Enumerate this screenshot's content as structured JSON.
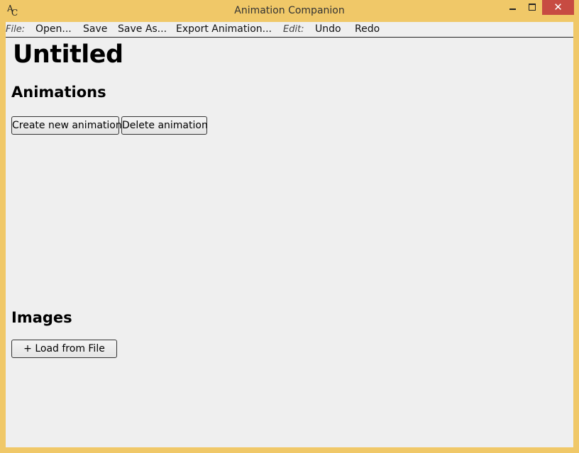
{
  "window": {
    "title": "Animation Companion",
    "icon_glyphs": {
      "a": "A",
      "c": "C"
    },
    "close_glyph": "✕"
  },
  "menubar": {
    "file_label": "File:",
    "file_items": [
      "Open...",
      "Save",
      "Save As...",
      "Export Animation..."
    ],
    "edit_label": "Edit:",
    "edit_items": [
      "Undo",
      "Redo"
    ]
  },
  "document": {
    "title": "Untitled"
  },
  "animations": {
    "heading": "Animations",
    "create_label": "Create new animation",
    "delete_label": "Delete animation"
  },
  "images": {
    "heading": "Images",
    "load_label": "+ Load from File"
  },
  "colors": {
    "frame": "#f0c868",
    "client_bg": "#efefef",
    "close_button": "#c74b42"
  },
  "icons": [
    "app-icon",
    "minimize-icon",
    "maximize-icon",
    "close-icon"
  ]
}
